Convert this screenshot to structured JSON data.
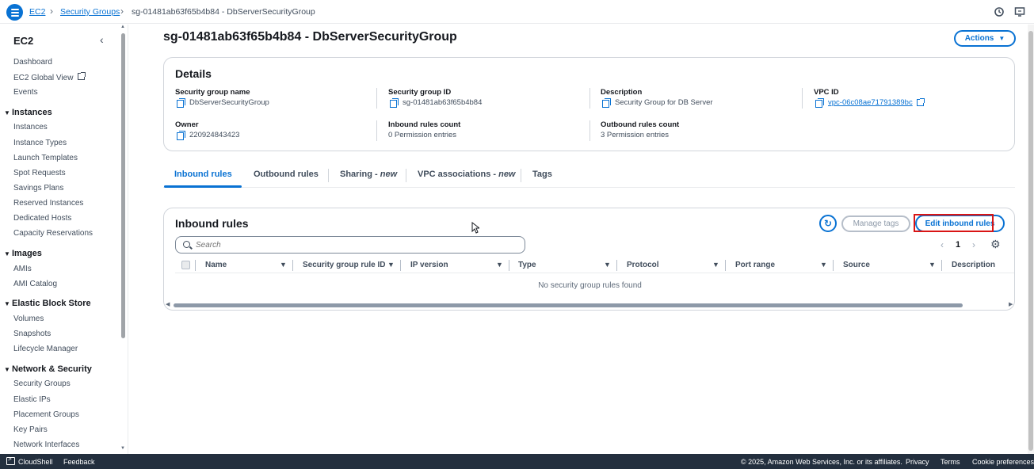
{
  "breadcrumb": {
    "items": [
      "EC2",
      "Security Groups",
      "sg-01481ab63f65b4b84 - DbServerSecurityGroup"
    ]
  },
  "sidebar": {
    "title": "EC2",
    "top_items": [
      "Dashboard",
      "EC2 Global View",
      "Events"
    ],
    "sections": [
      {
        "title": "Instances",
        "items": [
          "Instances",
          "Instance Types",
          "Launch Templates",
          "Spot Requests",
          "Savings Plans",
          "Reserved Instances",
          "Dedicated Hosts",
          "Capacity Reservations"
        ]
      },
      {
        "title": "Images",
        "items": [
          "AMIs",
          "AMI Catalog"
        ]
      },
      {
        "title": "Elastic Block Store",
        "items": [
          "Volumes",
          "Snapshots",
          "Lifecycle Manager"
        ]
      },
      {
        "title": "Network & Security",
        "items": [
          "Security Groups",
          "Elastic IPs",
          "Placement Groups",
          "Key Pairs",
          "Network Interfaces"
        ]
      }
    ]
  },
  "page": {
    "title": "sg-01481ab63f65b4b84 - DbServerSecurityGroup",
    "actions_label": "Actions"
  },
  "details": {
    "title": "Details",
    "fields": [
      {
        "label": "Security group name",
        "value": "DbServerSecurityGroup"
      },
      {
        "label": "Security group ID",
        "value": "sg-01481ab63f65b4b84"
      },
      {
        "label": "Description",
        "value": "Security Group for DB Server"
      },
      {
        "label": "VPC ID",
        "value": "vpc-06c08ae71791389bc"
      },
      {
        "label": "Owner",
        "value": "220924843423"
      },
      {
        "label": "Inbound rules count",
        "value": "0 Permission entries"
      },
      {
        "label": "Outbound rules count",
        "value": "3 Permission entries"
      }
    ]
  },
  "tabs": [
    {
      "label": "Inbound rules",
      "suffix": "",
      "active": true
    },
    {
      "label": "Outbound rules",
      "suffix": "",
      "active": false
    },
    {
      "label": "Sharing - ",
      "suffix": "new",
      "active": false
    },
    {
      "label": "VPC associations - ",
      "suffix": "new",
      "active": false
    },
    {
      "label": "Tags",
      "suffix": "",
      "active": false
    }
  ],
  "rules": {
    "title": "Inbound rules",
    "manage_tags_label": "Manage tags",
    "edit_label": "Edit inbound rules",
    "search_placeholder": "Search",
    "page_number": "1",
    "columns": [
      "Name",
      "Security group rule ID",
      "IP version",
      "Type",
      "Protocol",
      "Port range",
      "Source",
      "Description"
    ],
    "empty_message": "No security group rules found"
  },
  "footer": {
    "cloudshell": "CloudShell",
    "feedback": "Feedback",
    "copyright": "© 2025, Amazon Web Services, Inc. or its affiliates.",
    "privacy": "Privacy",
    "terms": "Terms",
    "cookies": "Cookie preferences"
  },
  "colors": {
    "link": "#0972d3",
    "highlight_box": "#d91515",
    "footer_bg": "#232f3e"
  }
}
